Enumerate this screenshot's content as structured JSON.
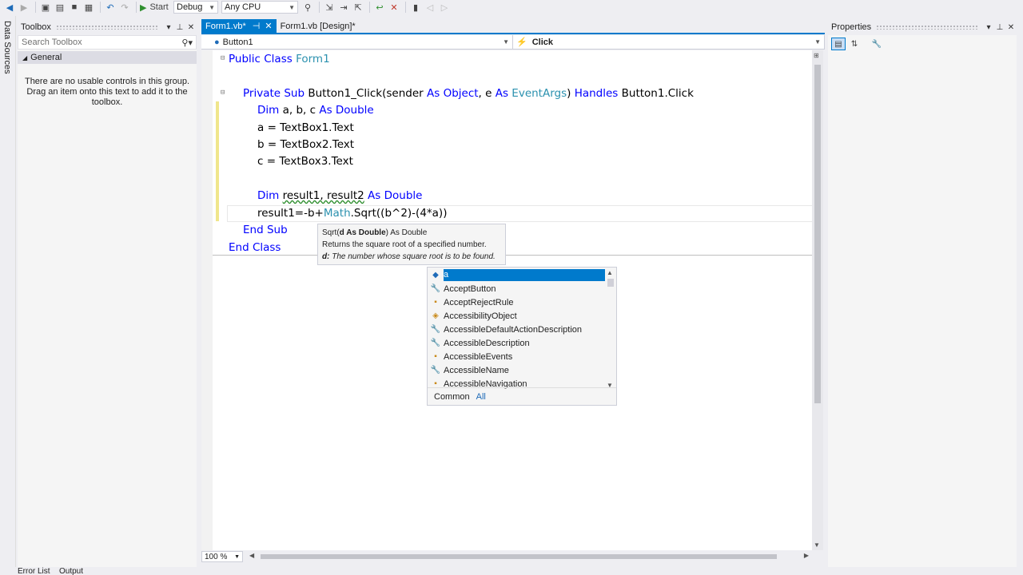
{
  "toolbar": {
    "start_label": "Start",
    "config": "Debug",
    "platform": "Any CPU"
  },
  "left_strip": {
    "label": "Data Sources"
  },
  "toolbox": {
    "title": "Toolbox",
    "search_placeholder": "Search Toolbox",
    "group": "General",
    "message": "There are no usable controls in this group. Drag an item onto this text to add it to the toolbox."
  },
  "tabs": [
    {
      "label": "Form1.vb*",
      "active": true
    },
    {
      "label": "Form1.vb [Design]*",
      "active": false
    }
  ],
  "nav": {
    "object": "Button1",
    "event": "Click"
  },
  "code": {
    "class_kw": "Public Class",
    "class_name": "Form1",
    "sub_kw": "Private Sub",
    "sub_sig_1": "Button1_Click(sender",
    "as1": "As",
    "obj": "Object",
    "sig_mid": ", e",
    "as2": "As",
    "evtargs": "EventArgs",
    "sig_close": ")",
    "handles": "Handles",
    "handles_target": "Button1.Click",
    "dim1": "Dim",
    "dim1_vars": "a, b, c",
    "as_double_1": "As Double",
    "line_a": "a = TextBox1.Text",
    "line_b": "b = TextBox2.Text",
    "line_c": "c = TextBox3.Text",
    "dim2": "Dim",
    "dim2_vars": "result1, result2",
    "as_double_2": "As Double",
    "result_pre": "result1=-b+",
    "math": "Math",
    "result_post": ".Sqrt((b^2)-(4*a))",
    "end_sub": "End Sub",
    "end_class": "End Class"
  },
  "tooltip": {
    "sig_pre": "Sqrt(",
    "sig_bold": "d As Double",
    "sig_post": ") As Double",
    "desc": "Returns the square root of a specified number.",
    "param_name": "d:",
    "param_desc": "The number whose square root is to be found."
  },
  "completion": {
    "items": [
      {
        "icon": "variable-icon",
        "label": "a"
      },
      {
        "icon": "wrench-icon",
        "label": "AcceptButton"
      },
      {
        "icon": "event-icon",
        "label": "AcceptRejectRule"
      },
      {
        "icon": "class-icon",
        "label": "AccessibilityObject"
      },
      {
        "icon": "wrench-icon",
        "label": "AccessibleDefaultActionDescription"
      },
      {
        "icon": "wrench-icon",
        "label": "AccessibleDescription"
      },
      {
        "icon": "event-icon",
        "label": "AccessibleEvents"
      },
      {
        "icon": "wrench-icon",
        "label": "AccessibleName"
      },
      {
        "icon": "event-icon",
        "label": "AccessibleNavigation"
      }
    ],
    "tab_common": "Common",
    "tab_all": "All"
  },
  "zoom": "100 %",
  "properties": {
    "title": "Properties"
  },
  "bottom": {
    "error_list": "Error List",
    "output": "Output"
  },
  "colors": {
    "accent": "#007acc",
    "keyword": "#0000ff",
    "type": "#2b91af"
  }
}
